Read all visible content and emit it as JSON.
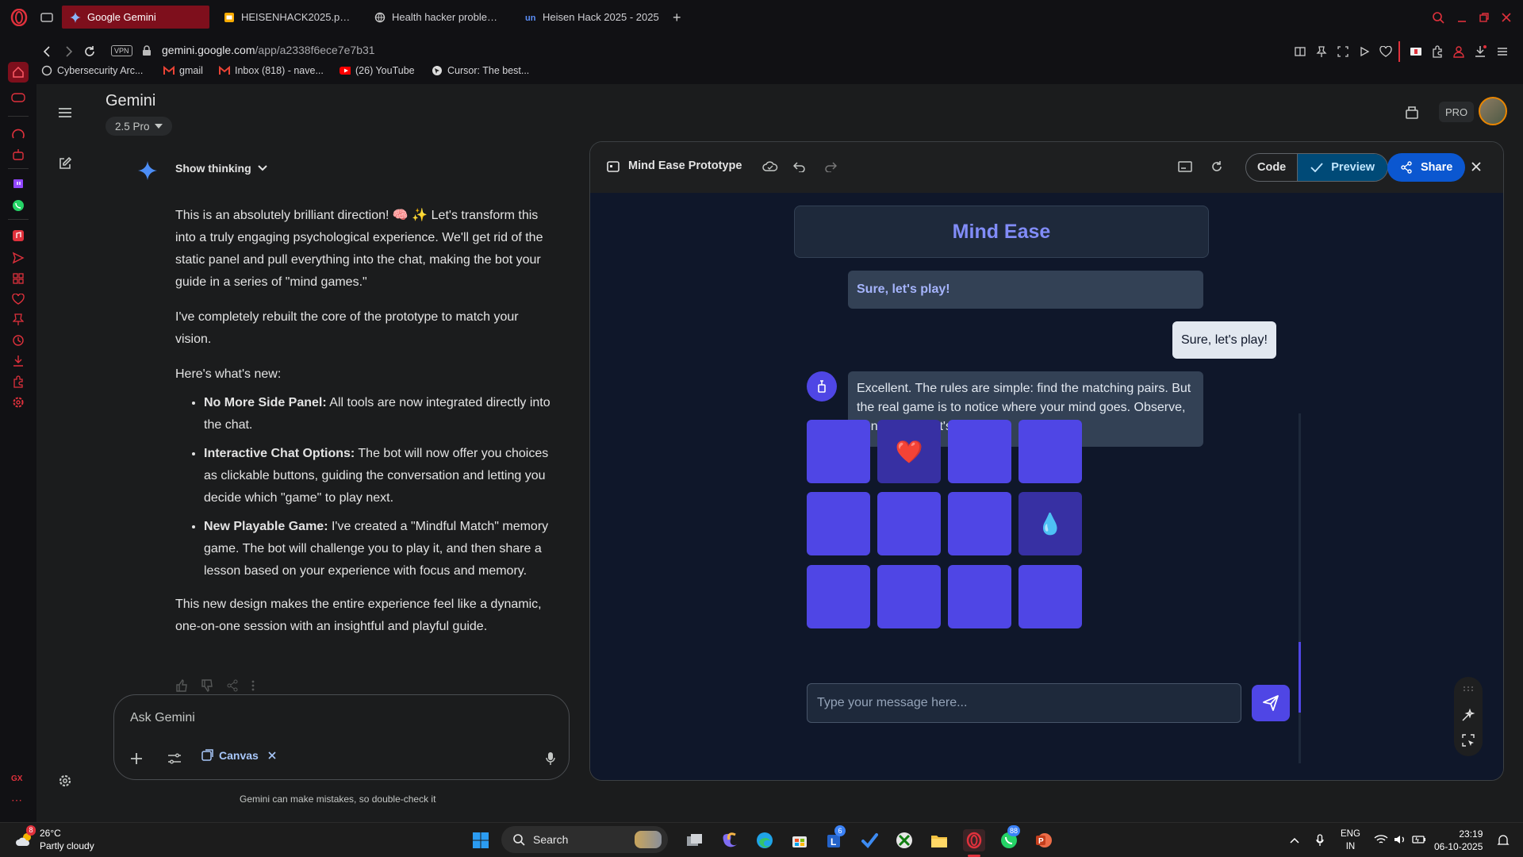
{
  "browser": {
    "tabs": [
      {
        "label": "Google Gemini",
        "active": true
      },
      {
        "label": "HEISENHACK2025.pptx"
      },
      {
        "label": "Health hacker problem st"
      },
      {
        "label": "Heisen Hack 2025 - 2025"
      }
    ],
    "new_tab": "+",
    "vpn": "VPN",
    "url_host": "gemini.google.com",
    "url_path": "/app/a2338f6ece7e7b31",
    "bookmarks": [
      {
        "label": "Cybersecurity Arc..."
      },
      {
        "label": "gmail"
      },
      {
        "label": "Inbox (818) - nave..."
      },
      {
        "label": "(26) YouTube"
      },
      {
        "label": "Cursor: The best..."
      }
    ]
  },
  "gemini": {
    "title": "Gemini",
    "model": "2.5 Pro",
    "pro_badge": "PRO",
    "show_thinking": "Show thinking",
    "response": {
      "p1a": "This is an absolutely brilliant direction! 🧠 ✨ Let's transform this into a truly engaging psychological experience. We'll get rid of the static panel and pull everything into the chat, making the bot your guide in a series of \"mind games.\"",
      "p2": "I've completely rebuilt the core of the prototype to match your vision.",
      "p3": "Here's what's new:",
      "items": [
        {
          "title": "No More Side Panel:",
          "text": " All tools are now integrated directly into the chat."
        },
        {
          "title": "Interactive Chat Options:",
          "text": " The bot will now offer you choices as clickable buttons, guiding the conversation and letting you decide which \"game\" to play next."
        },
        {
          "title": "New Playable Game:",
          "text": " I've created a \"Mindful Match\" memory game. The bot will challenge you to play it, and then share a lesson based on your experience with focus and memory."
        }
      ],
      "p4": "This new design makes the entire experience feel like a dynamic, one-on-one session with an insightful and playful guide."
    },
    "composer": {
      "placeholder": "Ask Gemini",
      "canvas_label": "Canvas"
    },
    "disclaimer": "Gemini can make mistakes, so double-check it"
  },
  "canvas": {
    "title": "Mind Ease Prototype",
    "code_label": "Code",
    "preview_label": "Preview",
    "share_label": "Share"
  },
  "app": {
    "header": "Mind Ease",
    "messages": [
      {
        "role": "bot-option",
        "text": "Sure, let's play!"
      },
      {
        "role": "user",
        "text": "Sure, let's play!"
      },
      {
        "role": "bot",
        "text": "Excellent. The rules are simple: find the matching pairs. But the real game is to notice where your mind goes. Observe, don't judge. Let's begin."
      }
    ],
    "cards": [
      {
        "symbol": ""
      },
      {
        "symbol": "❤️"
      },
      {
        "symbol": ""
      },
      {
        "symbol": ""
      },
      {
        "symbol": ""
      },
      {
        "symbol": ""
      },
      {
        "symbol": ""
      },
      {
        "symbol": "💧"
      },
      {
        "symbol": ""
      },
      {
        "symbol": ""
      },
      {
        "symbol": ""
      },
      {
        "symbol": ""
      }
    ],
    "input_placeholder": "Type your message here..."
  },
  "taskbar": {
    "temp": "26°C",
    "weather": "Partly cloudy",
    "search": "Search",
    "lang1": "ENG",
    "lang2": "IN",
    "time": "23:19",
    "date": "06-10-2025",
    "badge_teams": "6",
    "badge_whatsapp": "88",
    "weather_badge": "8"
  },
  "colors": {
    "accent": "#4f46e5",
    "tab_active": "#7e0f1c",
    "opera_red": "#e0313c",
    "share_blue": "#0b57d0"
  }
}
